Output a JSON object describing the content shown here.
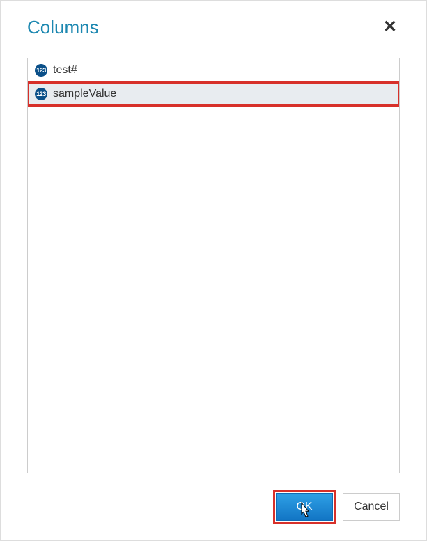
{
  "dialog": {
    "title": "Columns",
    "items": [
      {
        "type_label": "123",
        "name": "test#",
        "selected": false
      },
      {
        "type_label": "123",
        "name": "sampleValue",
        "selected": true
      }
    ],
    "buttons": {
      "ok": "OK",
      "cancel": "Cancel"
    }
  },
  "highlights": {
    "selected_item_index": 1,
    "ok_button_highlighted": true,
    "cursor_on_ok": true
  },
  "colors": {
    "accent": "#1b87b0",
    "highlight_border": "#d7302a",
    "primary_button": "#1275c4",
    "type_badge": "#0b5089"
  }
}
